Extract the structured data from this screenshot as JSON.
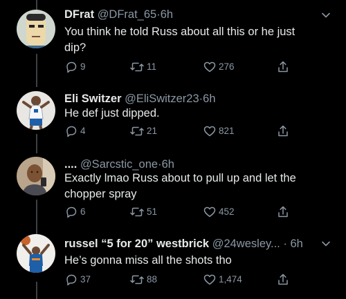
{
  "tweets": [
    {
      "name": "DFrat",
      "handle": "@DFrat_65",
      "time": "6h",
      "text_lines": [
        "You think he told Russ about all this or he just",
        "dip?"
      ],
      "replies": "9",
      "retweets": "11",
      "likes": "276"
    },
    {
      "name": "Eli Switzer",
      "handle": "@EliSwitzer23",
      "time": "6h",
      "text_lines": [
        "He def just dipped."
      ],
      "replies": "4",
      "retweets": "21",
      "likes": "821"
    },
    {
      "name": "....",
      "handle": "@Sarcstic_one",
      "time": "6h",
      "text_lines": [
        "Exactly lmao Russ about to pull up and let the",
        "chopper spray"
      ],
      "replies": "6",
      "retweets": "51",
      "likes": "452"
    },
    {
      "name": "russel “5 for 20” westbrick",
      "handle": "@24wesley...",
      "time": "6h",
      "text_lines": [
        "He’s gonna miss all the shots tho"
      ],
      "replies": "37",
      "retweets": "88",
      "likes": "1,474"
    }
  ],
  "separator": "·",
  "icons": {
    "reply": "reply-icon",
    "retweet": "retweet-icon",
    "like": "heart-icon",
    "share": "share-icon",
    "more": "chevron-down-icon"
  },
  "colors": {
    "background": "#000000",
    "text": "#e7e9ea",
    "secondary": "#8b98a5",
    "thread_line": "#3d4146"
  }
}
